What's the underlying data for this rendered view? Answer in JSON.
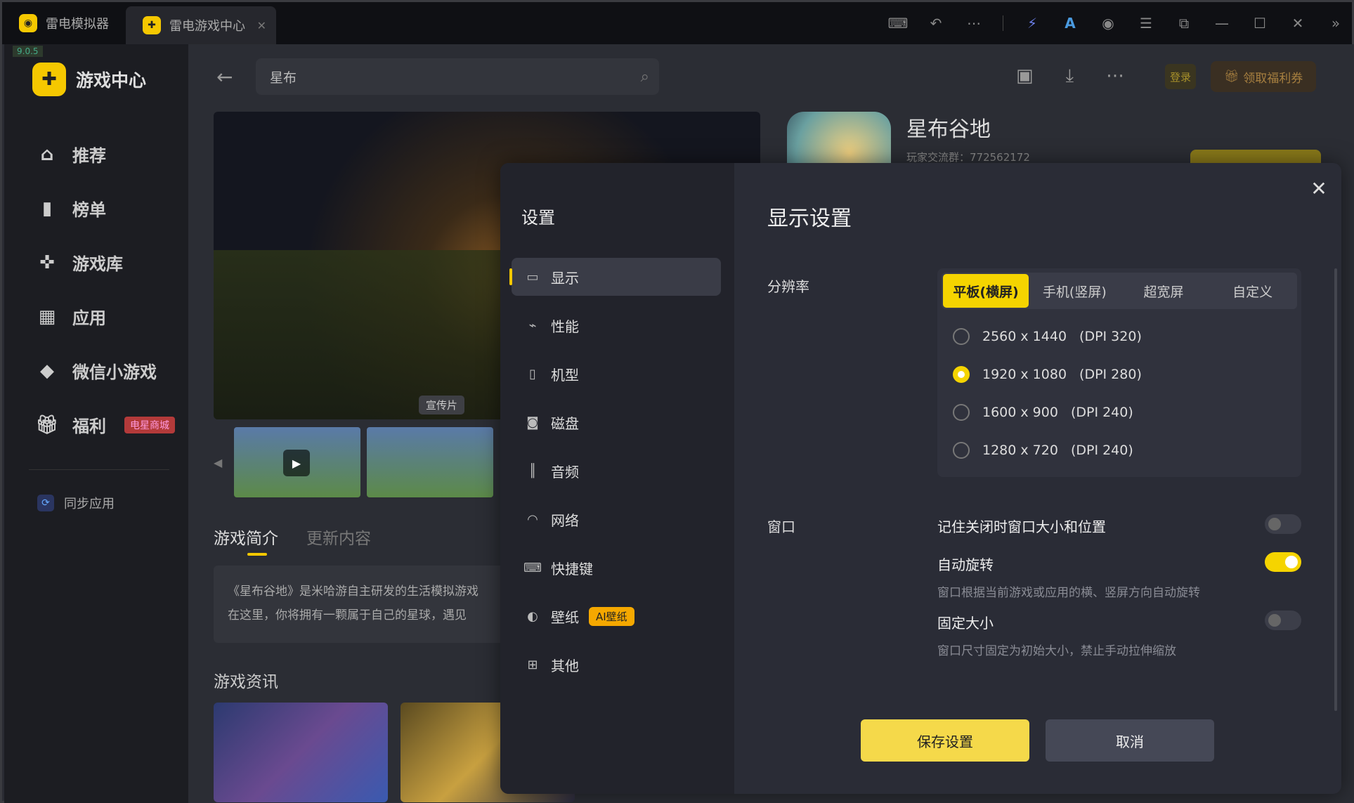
{
  "titlebar": {
    "tabs": [
      {
        "label": "雷电模拟器"
      },
      {
        "label": "雷电游戏中心"
      }
    ]
  },
  "version": "9.0.5",
  "sidebar": {
    "brand": "游戏中心",
    "items": [
      {
        "label": "推荐",
        "icon": "home-icon"
      },
      {
        "label": "榜单",
        "icon": "chart-icon"
      },
      {
        "label": "游戏库",
        "icon": "gamepad-icon"
      },
      {
        "label": "应用",
        "icon": "apps-icon"
      },
      {
        "label": "微信小游戏",
        "icon": "wechat-game-icon"
      },
      {
        "label": "福利",
        "icon": "gift-icon",
        "badge": "电星商城"
      }
    ],
    "sync": "同步应用"
  },
  "header": {
    "search_value": "星布",
    "login": "登录",
    "coupon": "领取福利券"
  },
  "content": {
    "video_tag": "宣传片",
    "tabs": [
      "游戏简介",
      "更新内容"
    ],
    "intro_lines": [
      "《星布谷地》是米哈游自主研发的生活模拟游戏",
      "在这里，你将拥有一颗属于自己的星球，遇见"
    ],
    "news_title": "游戏资讯",
    "game_name": "星布谷地",
    "game_group": "玩家交流群：772562172"
  },
  "settings": {
    "title": "设置",
    "menu": [
      {
        "label": "显示",
        "icon": "monitor-icon",
        "active": true
      },
      {
        "label": "性能",
        "icon": "performance-icon"
      },
      {
        "label": "机型",
        "icon": "phone-icon"
      },
      {
        "label": "磁盘",
        "icon": "disk-icon"
      },
      {
        "label": "音频",
        "icon": "audio-icon"
      },
      {
        "label": "网络",
        "icon": "wifi-icon"
      },
      {
        "label": "快捷键",
        "icon": "keyboard-icon"
      },
      {
        "label": "壁纸",
        "icon": "palette-icon",
        "badge": "AI壁纸"
      },
      {
        "label": "其他",
        "icon": "grid-icon"
      }
    ],
    "heading": "显示设置",
    "resolution_label": "分辨率",
    "modes": [
      "平板(横屏)",
      "手机(竖屏)",
      "超宽屏",
      "自定义"
    ],
    "selected_mode": "平板(横屏)",
    "resolutions": [
      {
        "res": "2560 x 1440",
        "dpi": "(DPI 320)",
        "selected": false
      },
      {
        "res": "1920 x 1080",
        "dpi": "(DPI 280)",
        "selected": true
      },
      {
        "res": "1600 x 900",
        "dpi": "(DPI 240)",
        "selected": false
      },
      {
        "res": "1280 x 720",
        "dpi": "(DPI 240)",
        "selected": false
      }
    ],
    "window_label": "窗口",
    "options": [
      {
        "title": "记住关闭时窗口大小和位置",
        "desc": "",
        "on": false
      },
      {
        "title": "自动旋转",
        "desc": "窗口根据当前游戏或应用的横、竖屏方向自动旋转",
        "on": true
      },
      {
        "title": "固定大小",
        "desc": "窗口尺寸固定为初始大小，禁止手动拉伸缩放",
        "on": false
      }
    ],
    "save": "保存设置",
    "cancel": "取消"
  },
  "colors": {
    "accent": "#f5d400",
    "modal_bg": "#2a2c36"
  }
}
